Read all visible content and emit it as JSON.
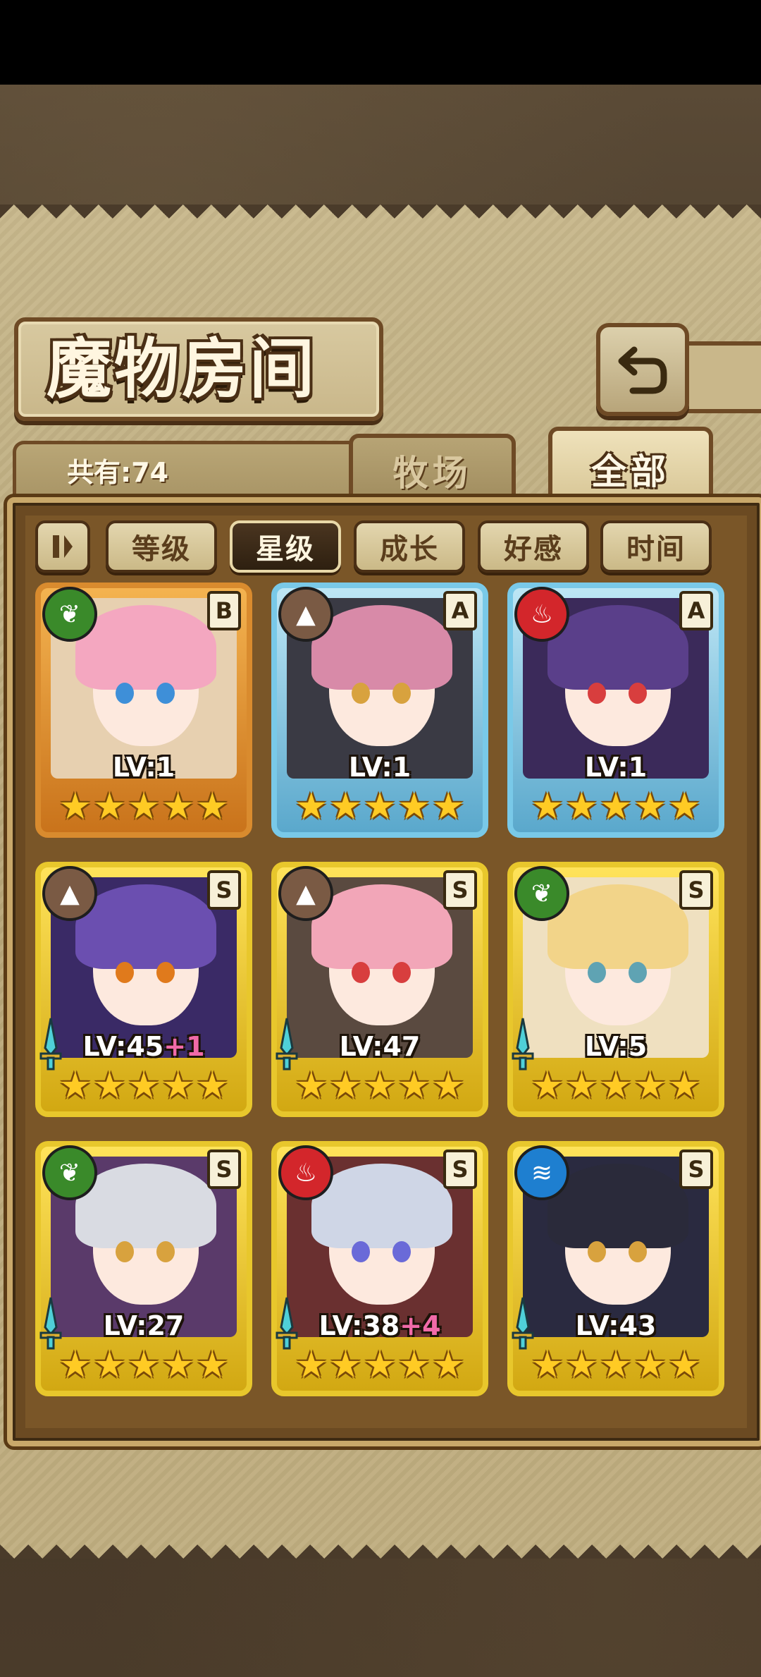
{
  "page_title": "魔物房间",
  "count_label": "共有:74",
  "tabs": [
    {
      "label": "牧场",
      "active": false
    },
    {
      "label": "全部",
      "active": true
    }
  ],
  "sort_filters": [
    {
      "label": "等级",
      "active": false
    },
    {
      "label": "星级",
      "active": true
    },
    {
      "label": "成长",
      "active": false
    },
    {
      "label": "好感",
      "active": false
    },
    {
      "label": "时间",
      "active": false
    }
  ],
  "colors": {
    "nature": "#3a8a2a",
    "earth": "#7a5a44",
    "fire": "#d3262b",
    "water": "#1e7fd0"
  },
  "monsters": [
    {
      "element": "nature-icon",
      "rank": "B",
      "level": "LV:1",
      "bonus": "",
      "stars": 5,
      "has_weapon": false
    },
    {
      "element": "earth-icon",
      "rank": "A",
      "level": "LV:1",
      "bonus": "",
      "stars": 5,
      "has_weapon": false
    },
    {
      "element": "fire-icon",
      "rank": "A",
      "level": "LV:1",
      "bonus": "",
      "stars": 5,
      "has_weapon": false
    },
    {
      "element": "earth-icon",
      "rank": "S",
      "level": "LV:45",
      "bonus": "+1",
      "stars": 5,
      "has_weapon": true
    },
    {
      "element": "earth-icon",
      "rank": "S",
      "level": "LV:47",
      "bonus": "",
      "stars": 5,
      "has_weapon": true
    },
    {
      "element": "nature-icon",
      "rank": "S",
      "level": "LV:5",
      "bonus": "",
      "stars": 5,
      "has_weapon": true
    },
    {
      "element": "nature-icon",
      "rank": "S",
      "level": "LV:27",
      "bonus": "",
      "stars": 5,
      "has_weapon": true
    },
    {
      "element": "fire-icon",
      "rank": "S",
      "level": "LV:38",
      "bonus": "+4",
      "stars": 5,
      "has_weapon": true
    },
    {
      "element": "water-icon",
      "rank": "S",
      "level": "LV:43",
      "bonus": "",
      "stars": 5,
      "has_weapon": true
    }
  ]
}
